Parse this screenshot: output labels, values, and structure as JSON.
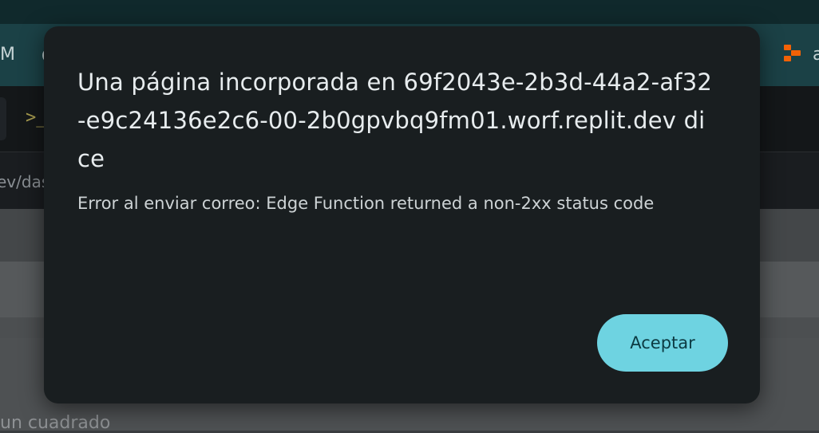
{
  "background": {
    "tab_left_text": "M",
    "tab_left_char": "C",
    "tab_right_text": "a",
    "terminal_icon": "terminal-icon",
    "url_fragment": "ev/das",
    "content_text": "un cuadrado"
  },
  "dialog": {
    "title": "Una página incorporada en 69f2043e-2b3d-44a2-af32-e9c24136e2c6-00-2b0gpvbq9fm01.worf.replit.dev dice",
    "message": "Error al enviar correo: Edge Function returned a non-2xx status code",
    "accept_label": "Aceptar"
  },
  "colors": {
    "dialog_bg": "#191e20",
    "accent": "#6ed3e1",
    "replit_orange": "#f26207"
  }
}
